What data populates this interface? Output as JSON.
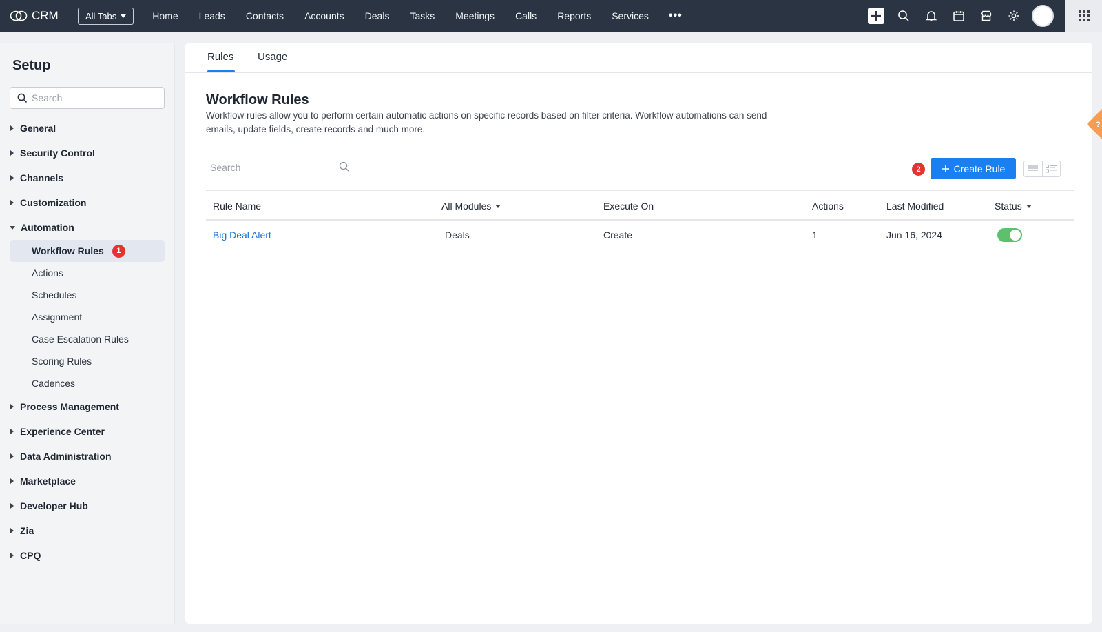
{
  "topbar": {
    "brand": "CRM",
    "all_tabs": "All Tabs",
    "links": [
      "Home",
      "Leads",
      "Contacts",
      "Accounts",
      "Deals",
      "Tasks",
      "Meetings",
      "Calls",
      "Reports",
      "Services"
    ],
    "more": "•••"
  },
  "sidebar": {
    "title": "Setup",
    "search_placeholder": "Search",
    "sections_before": [
      "General",
      "Security Control",
      "Channels",
      "Customization"
    ],
    "automation": {
      "label": "Automation",
      "items": [
        {
          "label": "Workflow Rules",
          "badge": "1"
        },
        {
          "label": "Actions"
        },
        {
          "label": "Schedules"
        },
        {
          "label": "Assignment"
        },
        {
          "label": "Case Escalation Rules"
        },
        {
          "label": "Scoring Rules"
        },
        {
          "label": "Cadences"
        }
      ]
    },
    "sections_after": [
      "Process Management",
      "Experience Center",
      "Data Administration",
      "Marketplace",
      "Developer Hub",
      "Zia",
      "CPQ"
    ]
  },
  "main": {
    "tabs": [
      "Rules",
      "Usage"
    ],
    "title": "Workflow Rules",
    "description": "Workflow rules allow you to perform certain automatic actions on specific records based on filter criteria. Workflow automations can send emails, update fields, create records and much more.",
    "search_placeholder": "Search",
    "badge": "2",
    "create_label": "Create Rule",
    "columns": [
      "Rule Name",
      "All Modules",
      "Execute On",
      "Actions",
      "Last Modified",
      "Status"
    ],
    "rows": [
      {
        "name": "Big Deal Alert",
        "module": "Deals",
        "execute_on": "Create",
        "actions": "1",
        "last_modified": "Jun 16, 2024",
        "status_on": true
      }
    ]
  },
  "colors": {
    "accent": "#1a7ff0",
    "topbar": "#2b3442",
    "badge": "#e8322f",
    "toggle_on": "#5cc06d",
    "help": "#f59e53"
  }
}
